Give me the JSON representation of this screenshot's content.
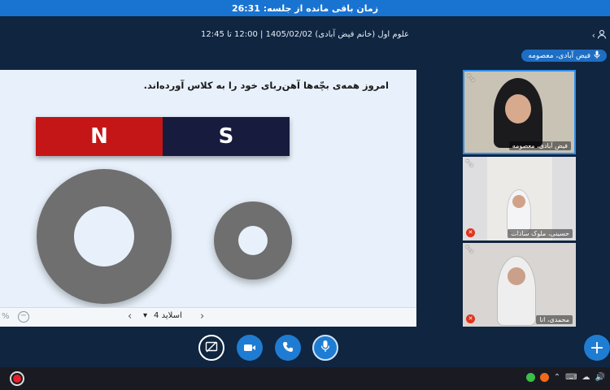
{
  "topbar": {
    "remaining_time_text": "زمان باقی مانده از جلسه: 26:31"
  },
  "header": {
    "session_info": "علوم اول (خانم فیض آبادی) 1405/02/02 | 12:00 تا 12:45",
    "participants_icon": "user-icon",
    "back_icon": "chevron-left-icon"
  },
  "speaker": {
    "label": "فیض آبادی، معصومه",
    "icon": "microphone-icon"
  },
  "slide": {
    "caption": "امروز همه‌ی بچّه‌ها آهن‌ربای خود را به کلاس آورده‌اند.",
    "magnet_north": "N",
    "magnet_south": "S",
    "colors": {
      "north": "#c41616",
      "south": "#171b3d",
      "ring": "#6f6f6f",
      "background": "#e8f1fb"
    }
  },
  "slide_nav": {
    "zoom_symbol": "−",
    "left_mark": "%",
    "prev_symbol": "‹",
    "next_symbol": "›",
    "current_slide": "اسلاید 4",
    "dropdown_symbol": "▾"
  },
  "videos": [
    {
      "name": "فیض آبادی، معصومه",
      "expand_symbol": "⤡",
      "muted": false
    },
    {
      "name": "حسینی، ملوک سادات",
      "expand_symbol": "⤡",
      "muted": true
    },
    {
      "name": "محمدی، انا",
      "expand_symbol": "⤡",
      "muted": true
    }
  ],
  "controls": {
    "screen_share": "screen-share-off-icon",
    "video": "video-camera-icon",
    "phone": "phone-icon",
    "mic": "microphone-icon",
    "plus": "+"
  },
  "taskbar": {
    "record_icon": "record-icon",
    "tray_symbols": [
      "⌃",
      "⌨",
      "☁",
      "🔊"
    ]
  },
  "accent_color": "#1f7cd3"
}
